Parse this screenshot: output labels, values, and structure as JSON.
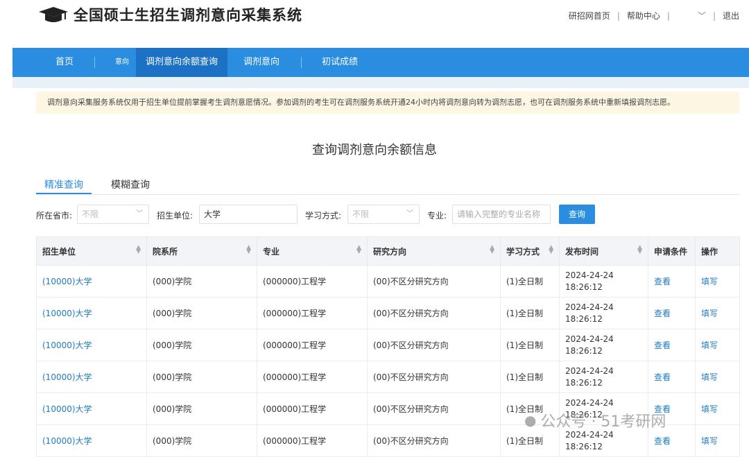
{
  "header": {
    "site_title": "全国硕士生招生调剂意向采集系统",
    "links": [
      "研招网首页",
      "帮助中心",
      "退出"
    ]
  },
  "nav": {
    "items": [
      "首页",
      "意向",
      "调剂意向余额查询",
      "调剂意向",
      "初试成绩"
    ],
    "active_index": 2
  },
  "notice": "调剂意向采集服务系统仅用于招生单位提前掌握考生调剂意愿情况。参加调剂的考生可在调剂服务系统开通24小时内将调剂意向转为调剂志愿，也可在调剂服务系统中重新填报调剂志愿。",
  "page_title": "查询调剂意向余额信息",
  "tabs": [
    "精准查询",
    "模糊查询"
  ],
  "filters": {
    "province_label": "所在省市:",
    "province_value": "不限",
    "unit_label": "招生单位:",
    "unit_value": "大学",
    "mode_label": "学习方式:",
    "mode_value": "不限",
    "major_label": "专业:",
    "major_placeholder": "请输入完整的专业名称",
    "search_label": "查询"
  },
  "table": {
    "columns": [
      "招生单位",
      "院系所",
      "专业",
      "研究方向",
      "学习方式",
      "发布时间",
      "申请条件",
      "操作"
    ],
    "rows": [
      [
        "(10000)大学",
        "(000)学院",
        "(000000)工程学",
        "(00)不区分研究方向",
        "(1)全日制",
        "2024-24-24 18:26:12",
        "查看",
        "填写"
      ],
      [
        "(10000)大学",
        "(000)学院",
        "(000000)工程学",
        "(00)不区分研究方向",
        "(1)全日制",
        "2024-24-24 18:26:12",
        "查看",
        "填写"
      ],
      [
        "(10000)大学",
        "(000)学院",
        "(000000)工程学",
        "(00)不区分研究方向",
        "(1)全日制",
        "2024-24-24 18:26:12",
        "查看",
        "填写"
      ],
      [
        "(10000)大学",
        "(000)学院",
        "(000000)工程学",
        "(00)不区分研究方向",
        "(1)全日制",
        "2024-24-24 18:26:12",
        "查看",
        "填写"
      ],
      [
        "(10000)大学",
        "(000)学院",
        "(000000)工程学",
        "(00)不区分研究方向",
        "(1)全日制",
        "2024-24-24 18:26:12",
        "查看",
        "填写"
      ],
      [
        "(10000)大学",
        "(000)学院",
        "(000000)工程学",
        "(00)不区分研究方向",
        "(1)全日制",
        "2024-24-24 18:26:12",
        "查看",
        "填写"
      ]
    ]
  },
  "watermark": "公众号 · 51考研网",
  "colors": {
    "primary": "#2a8de0",
    "nav_active": "#1b72c4",
    "notice_bg": "#fdf6e3",
    "link": "#1f7bc6"
  }
}
